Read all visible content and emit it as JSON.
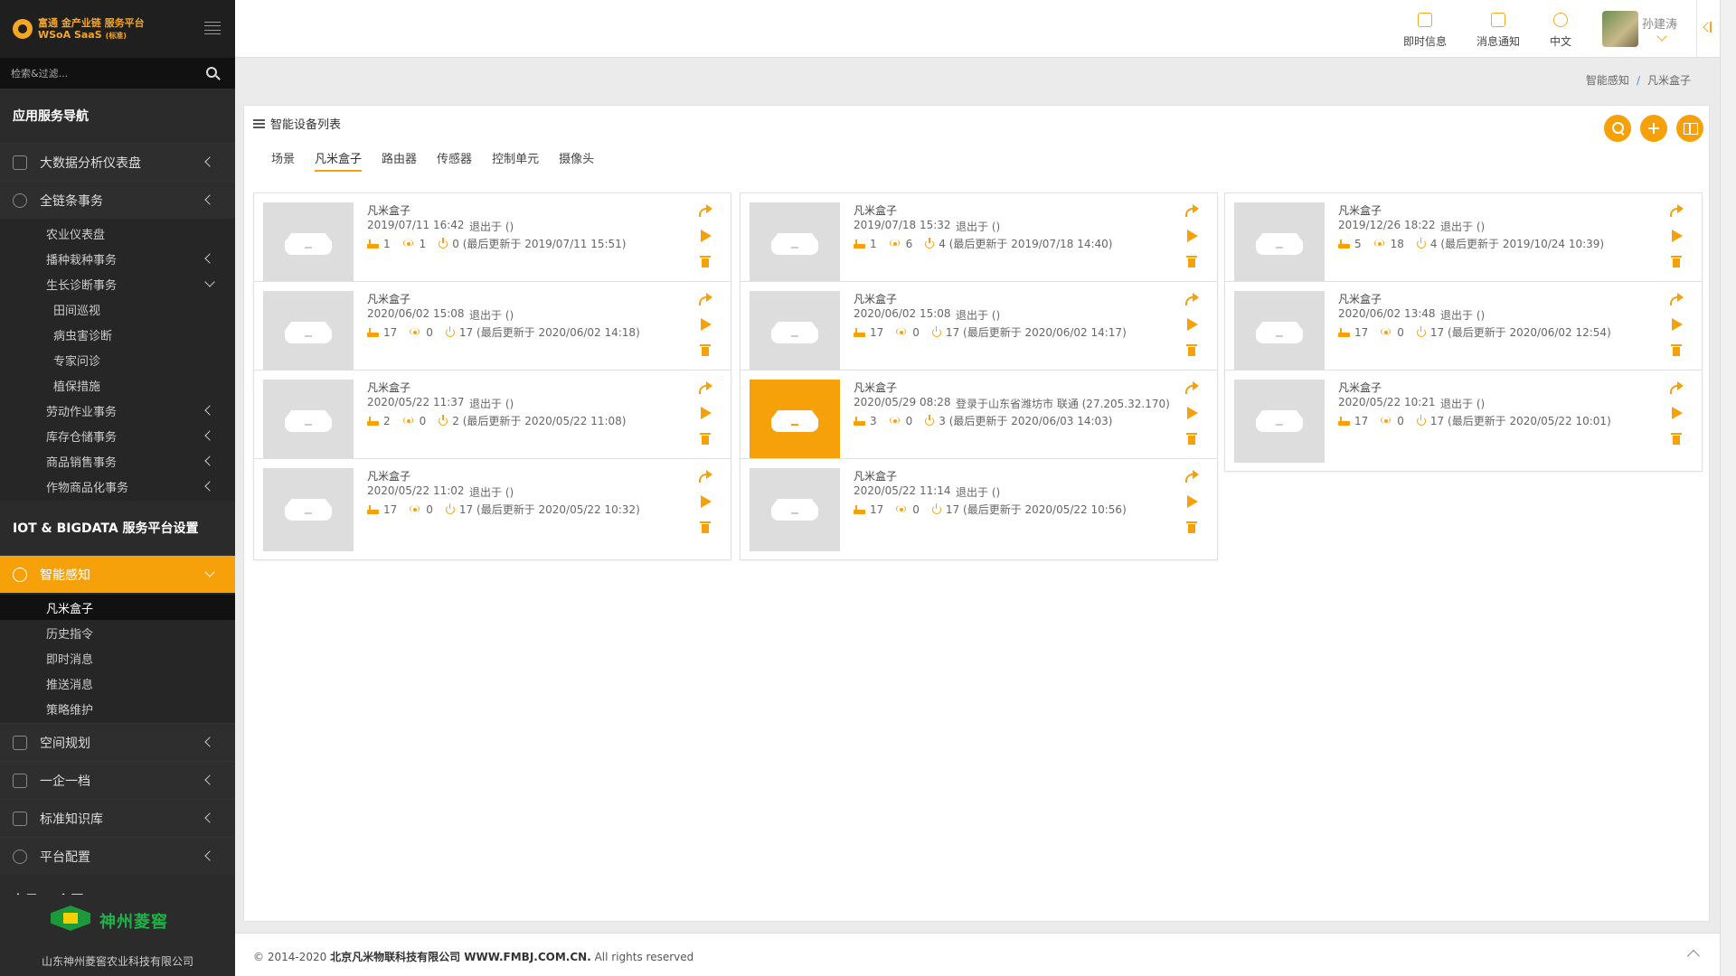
{
  "brand": {
    "line1": "富通 金产业链 服务平台",
    "line2": "WSoA SaaS",
    "sub": "(标准)"
  },
  "search": {
    "placeholder": "检索&过滤..."
  },
  "nav": {
    "section1": "应用服务导航",
    "bigdata": "大数据分析仪表盘",
    "chain": "全链条事务",
    "chain_sub": [
      "农业仪表盘",
      "播种栽种事务",
      "生长诊断事务"
    ],
    "growth_sub": [
      "田间巡视",
      "病虫害诊断",
      "专家问诊",
      "植保措施"
    ],
    "chain_sub2": [
      "劳动作业事务",
      "库存仓储事务",
      "商品销售事务",
      "作物商品化事务"
    ],
    "section2": "IOT & BIGDATA 服务平台设置",
    "smart": "智能感知",
    "smart_sub": [
      "凡米盒子",
      "历史指令",
      "即时消息",
      "推送消息",
      "策略维护"
    ],
    "space": "空间规划",
    "one": "一企一档",
    "knowledge": "标准知识库",
    "platform": "平台配置",
    "section3": "布局 & 主题"
  },
  "footer_brand": {
    "name": "神州菱窖",
    "company": "山东神州菱窖农业科技有限公司"
  },
  "topbar": {
    "instant": "即时信息",
    "notify": "消息通知",
    "lang": "中文",
    "user": "孙建涛"
  },
  "breadcrumb": {
    "parent": "智能感知",
    "current": "凡米盒子"
  },
  "panel": {
    "title": "智能设备列表",
    "tabs": [
      "场景",
      "凡米盒子",
      "路由器",
      "传感器",
      "控制单元",
      "摄像头"
    ]
  },
  "cards": [
    {
      "name": "凡米盒子",
      "time": "2019/07/11 16:42",
      "status": "退出于 ()",
      "a": "1",
      "b": "1",
      "c": "0 (最后更新于 2019/07/11 15:51)"
    },
    {
      "name": "凡米盒子",
      "time": "2019/07/18 15:32",
      "status": "退出于 ()",
      "a": "1",
      "b": "6",
      "c": "4 (最后更新于 2019/07/18 14:40)"
    },
    {
      "name": "凡米盒子",
      "time": "2019/12/26 18:22",
      "status": "退出于 ()",
      "a": "5",
      "b": "18",
      "c": "4 (最后更新于 2019/10/24 10:39)"
    },
    {
      "name": "凡米盒子",
      "time": "2020/06/02 15:08",
      "status": "退出于 ()",
      "a": "17",
      "b": "0",
      "c": "17 (最后更新于 2020/06/02 14:18)"
    },
    {
      "name": "凡米盒子",
      "time": "2020/06/02 15:08",
      "status": "退出于 ()",
      "a": "17",
      "b": "0",
      "c": "17 (最后更新于 2020/06/02 14:17)"
    },
    {
      "name": "凡米盒子",
      "time": "2020/06/02 13:48",
      "status": "退出于 ()",
      "a": "17",
      "b": "0",
      "c": "17 (最后更新于 2020/06/02 12:54)"
    },
    {
      "name": "凡米盒子",
      "time": "2020/05/22 11:37",
      "status": "退出于 ()",
      "a": "2",
      "b": "0",
      "c": "2 (最后更新于 2020/05/22 11:08)"
    },
    {
      "name": "凡米盒子",
      "time": "2020/05/29 08:28",
      "status": "登录于山东省潍坊市 联通 (27.205.32.170)",
      "a": "3",
      "b": "0",
      "c": "3 (最后更新于 2020/06/03 14:03)"
    },
    {
      "name": "凡米盒子",
      "time": "2020/05/22 10:21",
      "status": "退出于 ()",
      "a": "17",
      "b": "0",
      "c": "17 (最后更新于 2020/05/22 10:01)"
    },
    {
      "name": "凡米盒子",
      "time": "2020/05/22 11:02",
      "status": "退出于 ()",
      "a": "17",
      "b": "0",
      "c": "17 (最后更新于 2020/05/22 10:32)"
    },
    {
      "name": "凡米盒子",
      "time": "2020/05/22 11:14",
      "status": "退出于 ()",
      "a": "17",
      "b": "0",
      "c": "17 (最后更新于 2020/05/22 10:56)"
    }
  ],
  "footer": {
    "prefix": "© 2014-2020",
    "company": "北京凡米物联科技有限公司 WWW.FMBJ.COM.CN.",
    "suffix": "All rights reserved"
  },
  "colors": {
    "accent": "#f7a10a",
    "sidebar": "#2b2b2b"
  }
}
